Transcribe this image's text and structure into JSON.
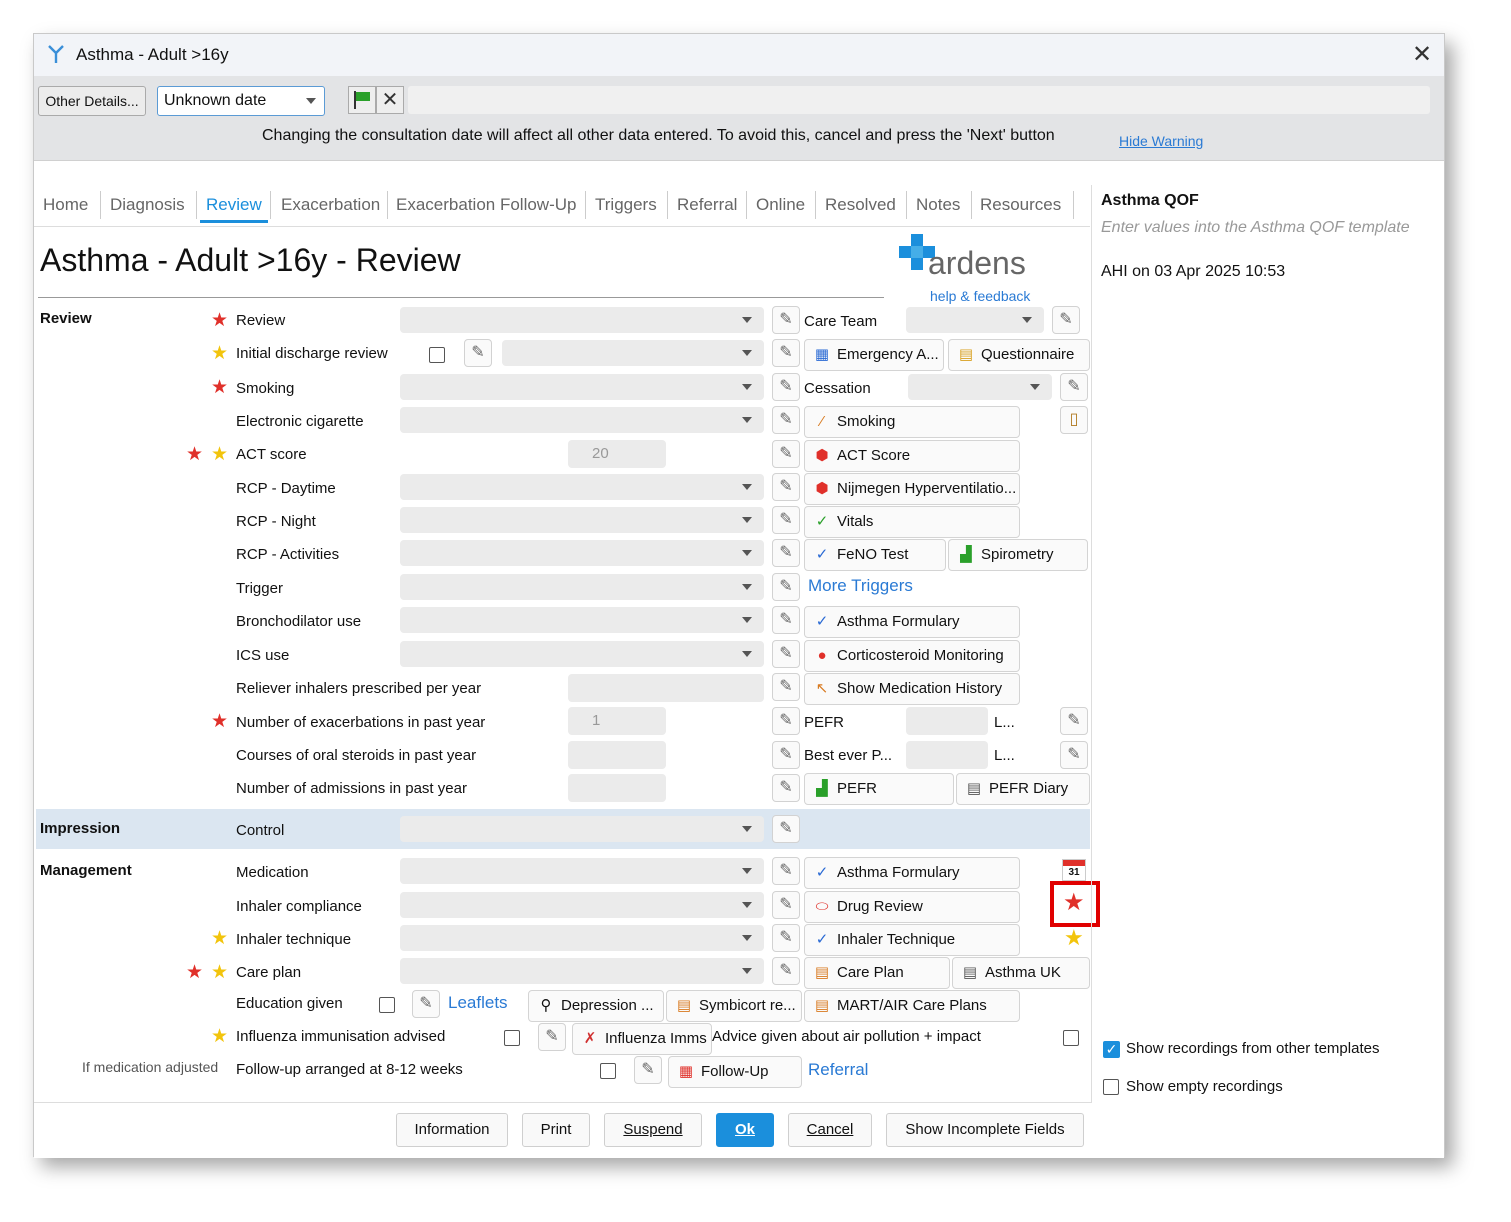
{
  "window": {
    "title": "Asthma - Adult >16y"
  },
  "toolbar": {
    "other_details": "Other Details...",
    "date_value": "Unknown date",
    "warning": "Changing the consultation date will affect all other data entered. To avoid this, cancel and press the 'Next' button",
    "hide_warning": "Hide Warning"
  },
  "tabs": [
    {
      "label": "Home"
    },
    {
      "label": "Diagnosis"
    },
    {
      "label": "Review"
    },
    {
      "label": "Exacerbation"
    },
    {
      "label": "Exacerbation Follow-Up"
    },
    {
      "label": "Triggers"
    },
    {
      "label": "Referral"
    },
    {
      "label": "Online"
    },
    {
      "label": "Resolved"
    },
    {
      "label": "Notes"
    },
    {
      "label": "Resources"
    }
  ],
  "page_title": "Asthma - Adult >16y - Review",
  "brand": {
    "name": "ardens",
    "help": "help & feedback"
  },
  "sections": {
    "review": "Review",
    "impression": "Impression",
    "management": "Management"
  },
  "fields": {
    "review": "Review",
    "initial_discharge": "Initial discharge review",
    "smoking": "Smoking",
    "ecig": "Electronic cigarette",
    "act": "ACT score",
    "act_value": "20",
    "rcp_day": "RCP - Daytime",
    "rcp_night": "RCP - Night",
    "rcp_act": "RCP - Activities",
    "trigger": "Trigger",
    "broncho": "Bronchodilator use",
    "ics": "ICS use",
    "reliever": "Reliever inhalers prescribed per year",
    "exacerbations": "Number of exacerbations in past year",
    "exacerbations_value": "1",
    "steroids": "Courses of oral steroids in past year",
    "admissions": "Number of admissions in past year",
    "control": "Control",
    "medication": "Medication",
    "compliance": "Inhaler compliance",
    "technique": "Inhaler technique",
    "care_plan": "Care plan",
    "education": "Education given",
    "influenza": "Influenza immunisation advised",
    "if_med": "If medication adjusted",
    "followup": "Follow-up arranged at 8-12 weeks"
  },
  "right_col": {
    "care_team": "Care Team",
    "emergency": "Emergency A...",
    "questionnaire": "Questionnaire",
    "cessation": "Cessation",
    "smoking_btn": "Smoking",
    "act_btn": "ACT Score",
    "nijmegen": "Nijmegen Hyperventilatio...",
    "vitals": "Vitals",
    "feno": "FeNO Test",
    "spirometry": "Spirometry",
    "more_triggers": "More Triggers",
    "asthma_formulary": "Asthma Formulary",
    "cortico": "Corticosteroid Monitoring",
    "med_history": "Show Medication History",
    "pefr": "PEFR",
    "pefr_unit": "L...",
    "best_ever": "Best ever P...",
    "best_unit": "L...",
    "pefr_btn": "PEFR",
    "pefr_diary": "PEFR Diary",
    "asthma_formulary2": "Asthma Formulary",
    "drug_review": "Drug Review",
    "inhaler_tech": "Inhaler Technique",
    "care_plan_btn": "Care Plan",
    "asthma_uk": "Asthma UK",
    "leaflets": "Leaflets",
    "depression": "Depression ...",
    "symbicort": "Symbicort re...",
    "mart": "MART/AIR Care Plans",
    "influenza_imms": "Influenza Imms",
    "air_pollution": "Advice given about air pollution + impact",
    "followup_btn": "Follow-Up",
    "referral": "Referral",
    "calendar_day": "31"
  },
  "sidebar": {
    "title": "Asthma QOF",
    "subtitle": "Enter values into the Asthma QOF template",
    "recorded": "AHI on 03 Apr 2025 10:53",
    "show_other": "Show recordings from other templates",
    "show_empty": "Show empty recordings"
  },
  "footer": {
    "information": "Information",
    "print": "Print",
    "suspend": "Suspend",
    "ok": "Ok",
    "cancel": "Cancel",
    "incomplete": "Show Incomplete Fields"
  },
  "colors": {
    "accent": "#1b8fdc",
    "required_star": "#e0302a",
    "qof_star": "#f2c40c",
    "highlight_box": "#e00000"
  }
}
